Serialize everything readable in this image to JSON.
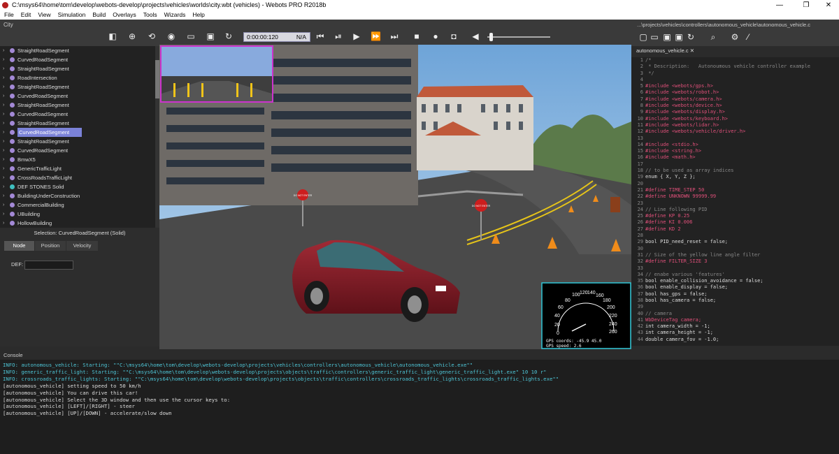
{
  "window": {
    "title": "C:\\msys64\\home\\tom\\develop\\webots-develop\\projects\\vehicles\\worlds\\city.wbt (vehicles) - Webots PRO R2018b"
  },
  "menu": [
    "File",
    "Edit",
    "View",
    "Simulation",
    "Build",
    "Overlays",
    "Tools",
    "Wizards",
    "Help"
  ],
  "toolbar": {
    "scene_title": "City",
    "time": "0:00:00:120",
    "speed": "N/A"
  },
  "scene_tree": [
    {
      "label": "StraightRoadSegment",
      "color": "purple"
    },
    {
      "label": "CurvedRoadSegment",
      "color": "purple"
    },
    {
      "label": "StraightRoadSegment",
      "color": "purple"
    },
    {
      "label": "RoadIntersection",
      "color": "purple"
    },
    {
      "label": "StraightRoadSegment",
      "color": "purple"
    },
    {
      "label": "CurvedRoadSegment",
      "color": "purple"
    },
    {
      "label": "StraightRoadSegment",
      "color": "purple"
    },
    {
      "label": "CurvedRoadSegment",
      "color": "purple"
    },
    {
      "label": "StraightRoadSegment",
      "color": "purple"
    },
    {
      "label": "CurvedRoadSegment",
      "color": "purple",
      "selected": true
    },
    {
      "label": "StraightRoadSegment",
      "color": "purple"
    },
    {
      "label": "CurvedRoadSegment",
      "color": "purple"
    },
    {
      "label": "BmwX5",
      "color": "purple"
    },
    {
      "label": "GenericTrafficLight",
      "color": "purple"
    },
    {
      "label": "CrossRoadsTrafficLight",
      "color": "purple"
    },
    {
      "label": "DEF STONES Solid",
      "color": "teal"
    },
    {
      "label": "BuildingUnderConstruction",
      "color": "purple"
    },
    {
      "label": "CommercialBuilding",
      "color": "purple"
    },
    {
      "label": "UBuilding",
      "color": "purple"
    },
    {
      "label": "HollowBuilding",
      "color": "purple"
    }
  ],
  "field_editor": {
    "selection": "Selection: CurvedRoadSegment (Solid)",
    "tabs": [
      "Node",
      "Position",
      "Velocity"
    ],
    "def_label": "DEF:",
    "def_value": ""
  },
  "scene3d": {
    "sign1": "DO NOT ENTER",
    "sign2": "DO NOT ENTER",
    "gauge_ticks": [
      "0",
      "20",
      "40",
      "60",
      "80",
      "100",
      "120",
      "140",
      "160",
      "180",
      "200",
      "220",
      "240",
      "260"
    ],
    "gps_coords": "GPS coords: -45.9 45.0",
    "gps_speed": "GPS speed:  2.6"
  },
  "editor": {
    "path": "...\\projects\\vehicles\\controllers\\autonomous_vehicle\\autonomous_vehicle.c",
    "tab": "autonomous_vehicle.c",
    "lines": [
      {
        "n": "1",
        "t": "/*",
        "k": "com"
      },
      {
        "n": "2",
        "t": " * Description:   Autonoumous vehicle controller example",
        "k": "com"
      },
      {
        "n": "3",
        "t": " */",
        "k": "com"
      },
      {
        "n": "4",
        "t": "",
        "k": "txt"
      },
      {
        "n": "5",
        "t": "#include <webots/gps.h>",
        "k": "inc"
      },
      {
        "n": "6",
        "t": "#include <webots/robot.h>",
        "k": "inc"
      },
      {
        "n": "7",
        "t": "#include <webots/camera.h>",
        "k": "inc"
      },
      {
        "n": "8",
        "t": "#include <webots/device.h>",
        "k": "inc"
      },
      {
        "n": "9",
        "t": "#include <webots/display.h>",
        "k": "inc"
      },
      {
        "n": "10",
        "t": "#include <webots/keyboard.h>",
        "k": "inc"
      },
      {
        "n": "11",
        "t": "#include <webots/lidar.h>",
        "k": "inc"
      },
      {
        "n": "12",
        "t": "#include <webots/vehicle/driver.h>",
        "k": "inc"
      },
      {
        "n": "13",
        "t": "",
        "k": "txt"
      },
      {
        "n": "14",
        "t": "#include <stdio.h>",
        "k": "inc"
      },
      {
        "n": "15",
        "t": "#include <string.h>",
        "k": "inc"
      },
      {
        "n": "16",
        "t": "#include <math.h>",
        "k": "inc"
      },
      {
        "n": "17",
        "t": "",
        "k": "txt"
      },
      {
        "n": "18",
        "t": "// to be used as array indices",
        "k": "com"
      },
      {
        "n": "19",
        "t": "enum { X, Y, Z };",
        "k": "txt"
      },
      {
        "n": "20",
        "t": "",
        "k": "txt"
      },
      {
        "n": "21",
        "t": "#define TIME_STEP 50",
        "k": "inc"
      },
      {
        "n": "22",
        "t": "#define UNKNOWN 99999.99",
        "k": "inc"
      },
      {
        "n": "23",
        "t": "",
        "k": "txt"
      },
      {
        "n": "24",
        "t": "// Line following PID",
        "k": "com"
      },
      {
        "n": "25",
        "t": "#define KP 0.25",
        "k": "inc"
      },
      {
        "n": "26",
        "t": "#define KI 0.006",
        "k": "inc"
      },
      {
        "n": "27",
        "t": "#define KD 2",
        "k": "inc"
      },
      {
        "n": "28",
        "t": "",
        "k": "txt"
      },
      {
        "n": "29",
        "t": "bool PID_need_reset = false;",
        "k": "txt"
      },
      {
        "n": "30",
        "t": "",
        "k": "txt"
      },
      {
        "n": "31",
        "t": "// Size of the yellow line angle filter",
        "k": "com"
      },
      {
        "n": "32",
        "t": "#define FILTER_SIZE 3",
        "k": "inc"
      },
      {
        "n": "33",
        "t": "",
        "k": "txt"
      },
      {
        "n": "34",
        "t": "// enabe various 'features'",
        "k": "com"
      },
      {
        "n": "35",
        "t": "bool enable_collision_avoidance = false;",
        "k": "txt"
      },
      {
        "n": "36",
        "t": "bool enable_display = false;",
        "k": "txt"
      },
      {
        "n": "37",
        "t": "bool has_gps = false;",
        "k": "txt"
      },
      {
        "n": "38",
        "t": "bool has_camera = false;",
        "k": "txt"
      },
      {
        "n": "39",
        "t": "",
        "k": "txt"
      },
      {
        "n": "40",
        "t": "// camera",
        "k": "com"
      },
      {
        "n": "41",
        "t": "WbDeviceTag camera;",
        "k": "inc"
      },
      {
        "n": "42",
        "t": "int camera_width = -1;",
        "k": "txt"
      },
      {
        "n": "43",
        "t": "int camera_height = -1;",
        "k": "txt"
      },
      {
        "n": "44",
        "t": "double camera_fov = -1.0;",
        "k": "txt"
      }
    ]
  },
  "console": {
    "title": "Console",
    "lines": [
      {
        "t": "INFO: autonomous_vehicle: Starting: \"\"C:\\msys64\\home\\tom\\develop\\webots-develop\\projects\\vehicles\\controllers\\autonomous_vehicle\\autonomous_vehicle.exe\"\"",
        "k": "info"
      },
      {
        "t": "INFO: generic_traffic_light: Starting: \"\"C:\\msys64\\home\\tom\\develop\\webots-develop\\projects\\objects\\traffic\\controllers\\generic_traffic_light\\generic_traffic_light.exe\" 10 10 r\"",
        "k": "info"
      },
      {
        "t": "INFO: crossroads_traffic_lights: Starting: \"\"C:\\msys64\\home\\tom\\develop\\webots-develop\\projects\\objects\\traffic\\controllers\\crossroads_traffic_lights\\crossroads_traffic_lights.exe\"\"",
        "k": "info"
      },
      {
        "t": "[autonomous_vehicle] setting speed to 50 km/h",
        "k": "out"
      },
      {
        "t": "[autonomous_vehicle] You can drive this car!",
        "k": "out"
      },
      {
        "t": "[autonomous_vehicle] Select the 3D window and then use the cursor keys to:",
        "k": "out"
      },
      {
        "t": "[autonomous_vehicle] [LEFT]/[RIGHT] - steer",
        "k": "out"
      },
      {
        "t": "[autonomous_vehicle] [UP]/[DOWN] - accelerate/slow down",
        "k": "out"
      }
    ]
  }
}
